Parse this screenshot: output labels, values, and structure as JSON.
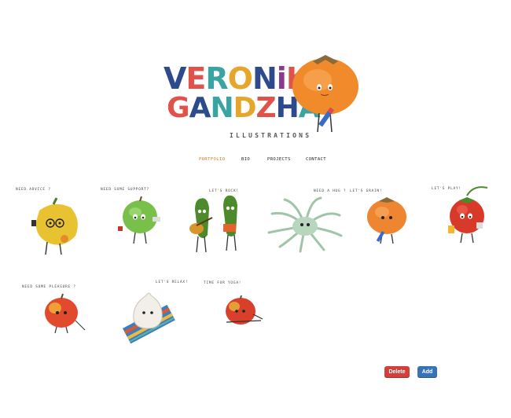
{
  "logo": {
    "line1": [
      "V",
      "E",
      "R",
      "O",
      "N",
      "i",
      "K",
      "A"
    ],
    "line2": [
      "G",
      "A",
      "N",
      "D",
      "Z",
      "H",
      "A"
    ],
    "colors1": [
      "#2d4a8c",
      "#e0534a",
      "#3aa4a4",
      "#e6a52b",
      "#2d4a8c",
      "#8a3b8f",
      "#e0534a",
      "#e6a52b"
    ],
    "colors2": [
      "#e0534a",
      "#2d4a8c",
      "#3aa4a4",
      "#e6a52b",
      "#e0534a",
      "#2d4a8c",
      "#3aa4a4"
    ],
    "subtitle": "ILLUSTRATIONS"
  },
  "nav": {
    "items": [
      "PORTFOLIO",
      "BIO",
      "PROJECTS",
      "CONTACT"
    ]
  },
  "captions": {
    "c1": "NEED ADVICE ?",
    "c2": "NEED SOME SUPPORT?",
    "c3": "LET'S ROCK!",
    "c4": "NEED A HUG ?",
    "c5": "LET'S GRAIN!",
    "c6": "LET'S PLAY!",
    "c7": "NEED SOME PLEASURE ?",
    "c8": "LET'S RELAX!",
    "c9": "TIME FOR YOGA!"
  },
  "buttons": {
    "delete": "Delete",
    "add": "Add"
  }
}
